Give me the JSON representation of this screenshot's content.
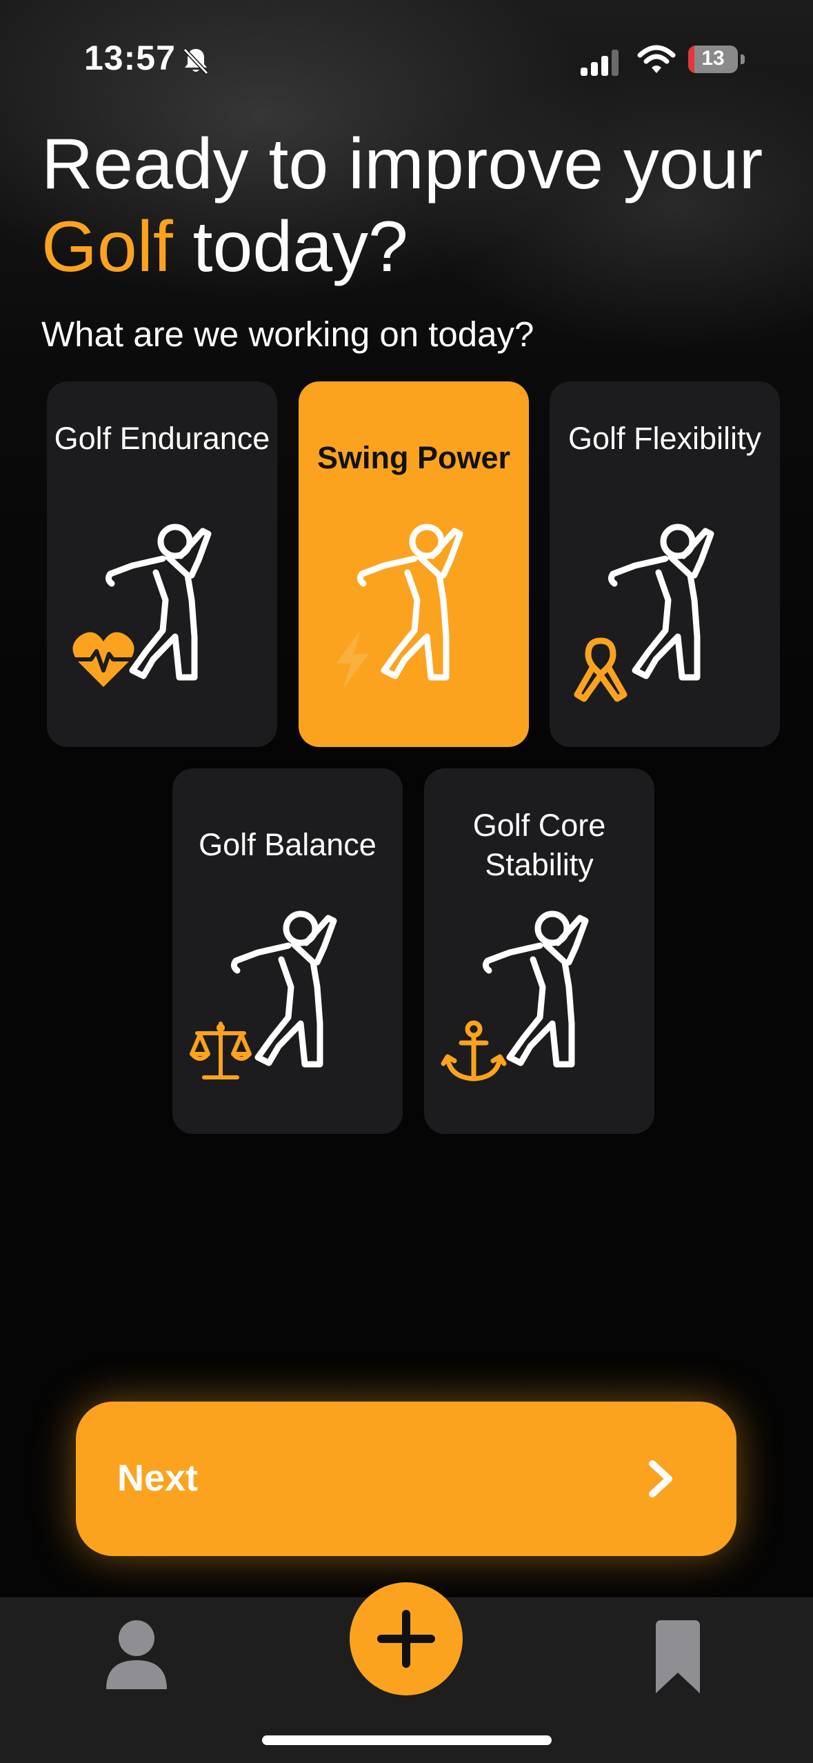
{
  "status_bar": {
    "time": "13:57",
    "battery": "13",
    "battery_level_percent": 13,
    "icons": [
      "bell-off-icon",
      "signal-icon",
      "wifi-icon",
      "battery-icon"
    ]
  },
  "header": {
    "title_line1": "Ready to improve your",
    "title_accent": "Golf",
    "title_rest": " today?",
    "subtitle": "What are we working on today?"
  },
  "options": [
    {
      "label": "Golf Endurance",
      "icon": "heart-pulse-icon",
      "selected": false
    },
    {
      "label": "Swing Power",
      "icon": "lightning-icon",
      "selected": true
    },
    {
      "label": "Golf Flexibility",
      "icon": "ribbon-icon",
      "selected": false
    },
    {
      "label": "Golf Balance",
      "icon": "scales-icon",
      "selected": false
    },
    {
      "label": "Golf Core Stability",
      "icon": "anchor-icon",
      "selected": false
    }
  ],
  "next_button": {
    "label": "Next",
    "icon": "chevron-right-icon"
  },
  "tab_bar": {
    "items": [
      "profile-icon",
      "plus-icon",
      "bookmark-icon"
    ]
  },
  "colors": {
    "accent": "#fba31f",
    "card_background": "#1c1c1e",
    "background": "#050505"
  }
}
